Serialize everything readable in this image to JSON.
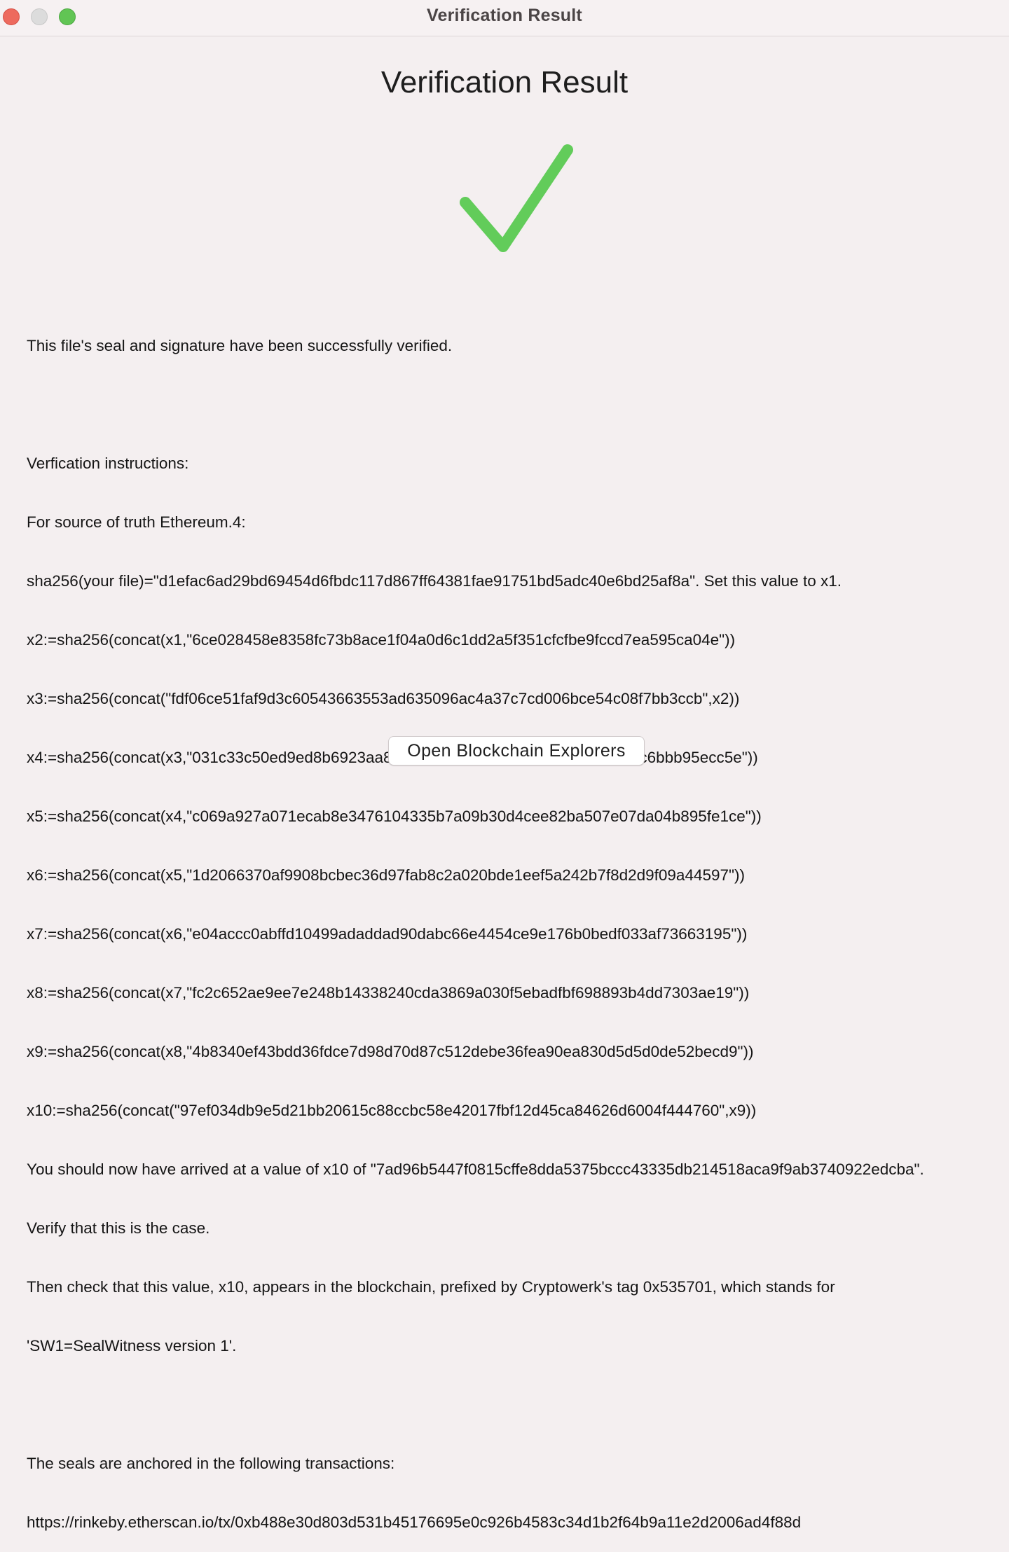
{
  "window": {
    "title": "Verification Result"
  },
  "main": {
    "heading": "Verification Result",
    "status_icon": "checkmark-icon",
    "status_color": "#62cc5a",
    "success_message": "This file's seal and signature have been successfully verified.",
    "instructions_header": "Verfication instructions:",
    "instructions": [
      "For source of truth Ethereum.4:",
      "sha256(your file)=\"d1efac6ad29bd69454d6fbdc117d867ff64381fae91751bd5adc40e6bd25af8a\". Set this value to x1.",
      "x2:=sha256(concat(x1,\"6ce028458e8358fc73b8ace1f04a0d6c1dd2a5f351cfcfbe9fccd7ea595ca04e\"))",
      "x3:=sha256(concat(\"fdf06ce51faf9d3c60543663553ad635096ac4a37c7cd006bce54c08f7bb3ccb\",x2))",
      "x4:=sha256(concat(x3,\"031c33c50ed9ed8b6923aa87d232c615af94ac225c8457184570c6bbb95ecc5e\"))",
      "x5:=sha256(concat(x4,\"c069a927a071ecab8e3476104335b7a09b30d4cee82ba507e07da04b895fe1ce\"))",
      "x6:=sha256(concat(x5,\"1d2066370af9908bcbec36d97fab8c2a020bde1eef5a242b7f8d2d9f09a44597\"))",
      "x7:=sha256(concat(x6,\"e04accc0abffd10499adaddad90dabc66e4454ce9e176b0bedf033af73663195\"))",
      "x8:=sha256(concat(x7,\"fc2c652ae9ee7e248b14338240cda3869a030f5ebadfbf698893b4dd7303ae19\"))",
      "x9:=sha256(concat(x8,\"4b8340ef43bdd36fdce7d98d70d87c512debe36fea90ea830d5d5d0de52becd9\"))",
      "x10:=sha256(concat(\"97ef034db9e5d21bb20615c88ccbc58e42017fbf12d45ca84626d6004f444760\",x9))",
      "You should now have arrived at a value of x10 of \"7ad96b5447f0815cffe8dda5375bccc43335db214518aca9f9ab3740922edcba\".",
      "Verify that this is the case.",
      "Then check that this value, x10, appears in the blockchain, prefixed by Cryptowerk's tag 0x535701, which stands for",
      "'SW1=SealWitness version 1'."
    ],
    "anchored_header": "The seals are anchored in the following transactions:",
    "transaction_url": "https://rinkeby.etherscan.io/tx/0xb488e30d803d531b45176695e0c926b4583c34d1b2f64b9a11e2d2006ad4f88d"
  },
  "actions": {
    "open_explorers_label": "Open Blockchain Explorers"
  }
}
